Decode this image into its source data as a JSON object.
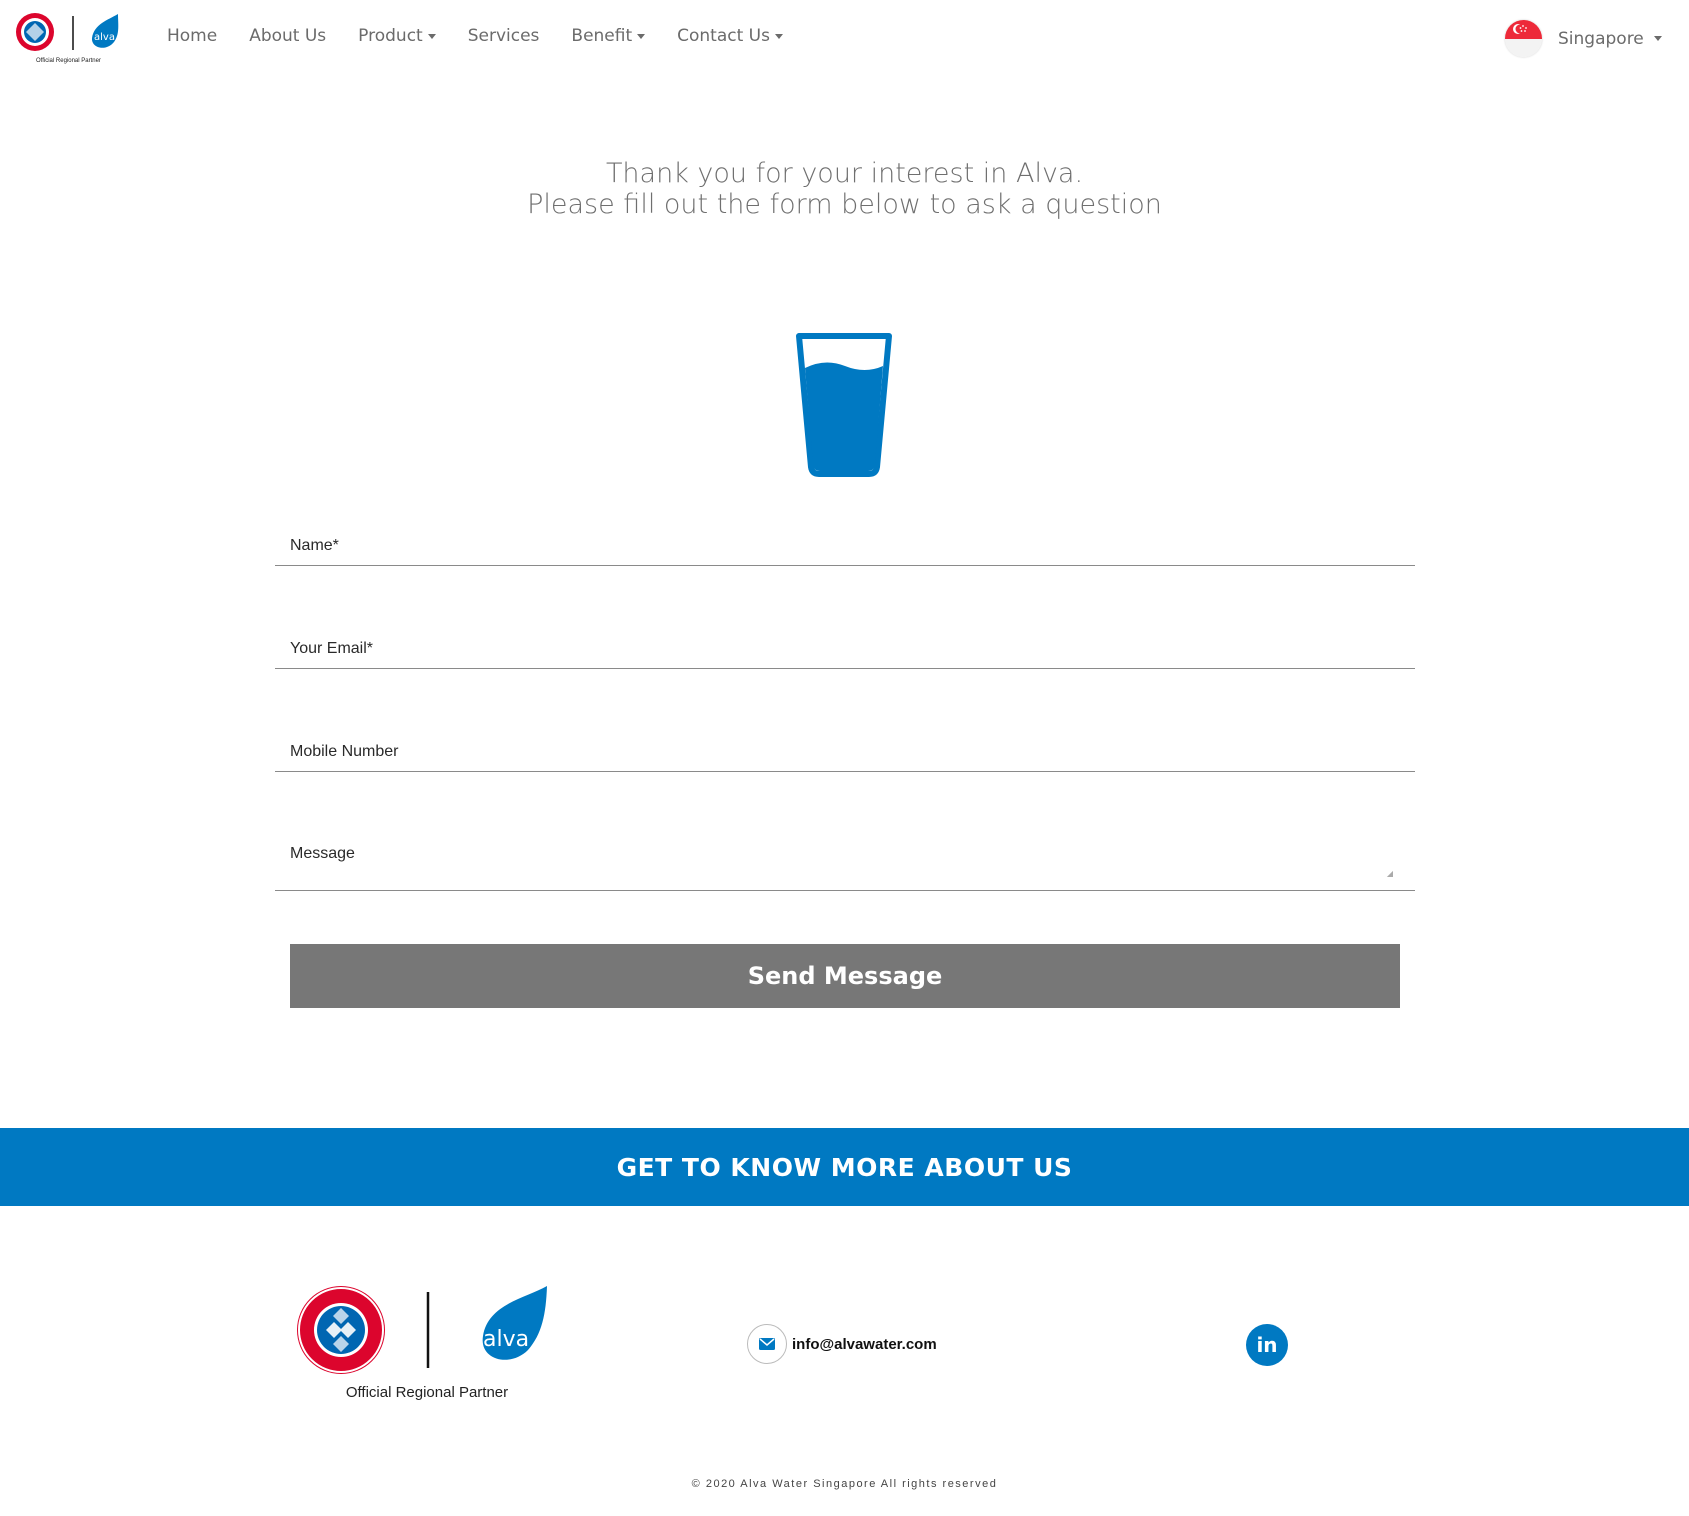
{
  "nav": {
    "items": [
      {
        "label": "Home",
        "dropdown": false
      },
      {
        "label": "About Us",
        "dropdown": false
      },
      {
        "label": "Product",
        "dropdown": true
      },
      {
        "label": "Services",
        "dropdown": false
      },
      {
        "label": "Benefit",
        "dropdown": true
      },
      {
        "label": "Contact Us",
        "dropdown": true
      }
    ],
    "country": "Singapore",
    "logo_caption": "Official Regional Partner"
  },
  "intro": {
    "line1": "Thank you for your interest in Alva.",
    "line2": "Please fill out the form below to ask a question"
  },
  "form": {
    "name_placeholder": "Name*",
    "email_placeholder": "Your Email*",
    "mobile_placeholder": "Mobile Number",
    "message_placeholder": "Message",
    "send_label": "Send Message"
  },
  "banner": {
    "text": "GET TO KNOW MORE ABOUT US"
  },
  "footer": {
    "partner": "Official Regional Partner",
    "email": "info@alvawater.com",
    "linkedin": "in",
    "copyright": "© 2020 Alva Water Singapore All rights reserved"
  },
  "colors": {
    "brand_blue": "#0079c2",
    "button_grey": "#777777",
    "fcb_red": "#dc052d"
  },
  "logos": {
    "fcb_text": "FC BAYERN MÜNCHEN",
    "alva_text": "alva"
  }
}
